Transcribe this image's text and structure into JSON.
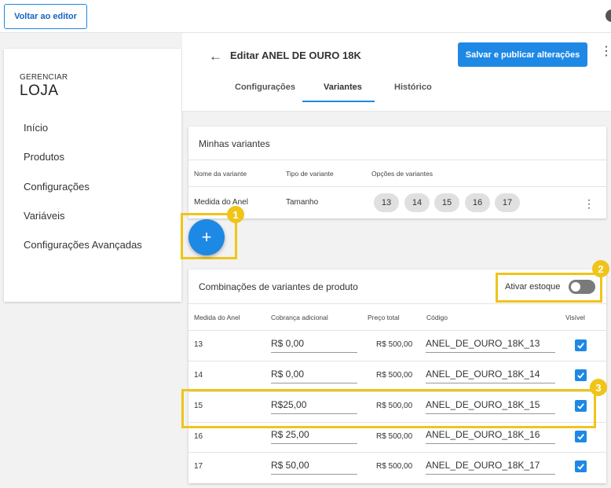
{
  "topbar": {
    "back_label": "Voltar ao editor"
  },
  "sidebar": {
    "small": "GERENCIAR",
    "big": "LOJA",
    "items": [
      {
        "label": "Início"
      },
      {
        "label": "Produtos"
      },
      {
        "label": "Configurações"
      },
      {
        "label": "Variáveis"
      },
      {
        "label": "Configurações Avançadas"
      }
    ]
  },
  "header": {
    "title": "Editar ANEL DE OURO 18K",
    "save_label": "Salvar e publicar alterações",
    "tabs": [
      {
        "label": "Configurações"
      },
      {
        "label": "Variantes"
      },
      {
        "label": "Histórico"
      }
    ],
    "active_tab": "Variantes"
  },
  "variants": {
    "title": "Minhas variantes",
    "columns": [
      "Nome da variante",
      "Tipo de variante",
      "Opções de variantes"
    ],
    "row": {
      "name": "Medida do Anel",
      "type": "Tamanho",
      "options": [
        "13",
        "14",
        "15",
        "16",
        "17"
      ]
    }
  },
  "fab": {
    "label": "+"
  },
  "badges": [
    "1",
    "2",
    "3"
  ],
  "combos": {
    "title": "Combinações de variantes de produto",
    "stock_label": "Ativar estoque",
    "stock_enabled": false,
    "columns": [
      "Medida do Anel",
      "Cobrança adicional",
      "Preço total",
      "Código",
      "Visível"
    ],
    "rows": [
      {
        "size": "13",
        "extra": "R$ 0,00",
        "total": "R$ 500,00",
        "code": "ANEL_DE_OURO_18K_13",
        "visible": true
      },
      {
        "size": "14",
        "extra": "R$ 0,00",
        "total": "R$ 500,00",
        "code": "ANEL_DE_OURO_18K_14",
        "visible": true
      },
      {
        "size": "15",
        "extra": "R$25,00",
        "total": "R$ 500,00",
        "code": "ANEL_DE_OURO_18K_15",
        "visible": true
      },
      {
        "size": "16",
        "extra": "R$ 25,00",
        "total": "R$ 500,00",
        "code": "ANEL_DE_OURO_18K_16",
        "visible": true
      },
      {
        "size": "17",
        "extra": "R$ 50,00",
        "total": "R$ 500,00",
        "code": "ANEL_DE_OURO_18K_17",
        "visible": true
      }
    ]
  },
  "colors": {
    "accent": "#1e88e5",
    "highlight": "#f0c419"
  }
}
